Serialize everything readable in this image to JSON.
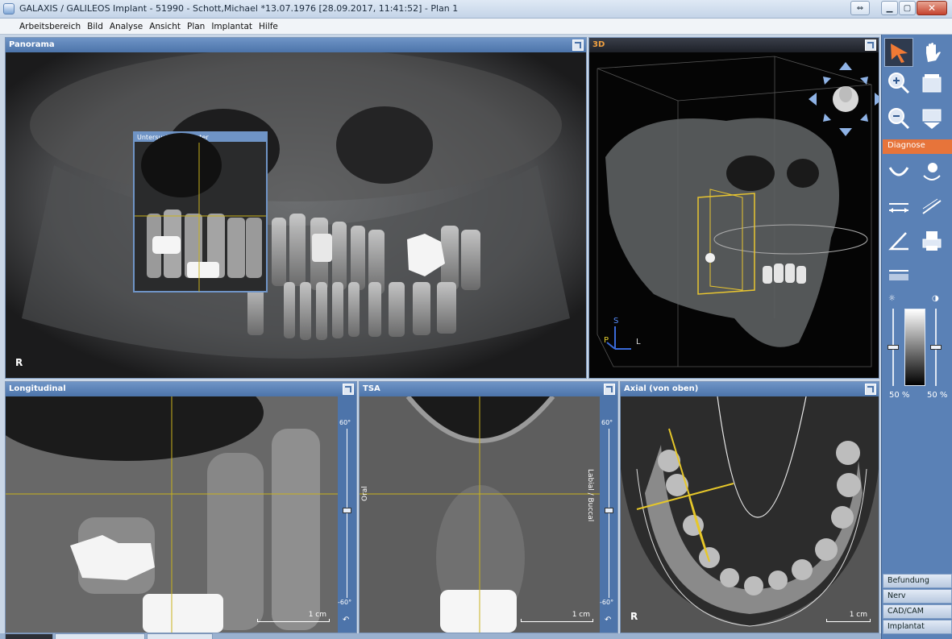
{
  "window": {
    "title": "GALAXIS / GALILEOS Implant - 51990 - Schott,Michael *13.07.1976 [28.09.2017, 11:41:52] - Plan 1"
  },
  "menu": [
    "Arbeitsbereich",
    "Bild",
    "Analyse",
    "Ansicht",
    "Plan",
    "Implantat",
    "Hilfe"
  ],
  "panels": {
    "panorama": {
      "title": "Panorama",
      "corner": "R",
      "exam_window": "Untersuchungsfenster"
    },
    "view3d": {
      "title": "3D",
      "axis_s": "S",
      "axis_p": "P",
      "axis_l": "L"
    },
    "longitudinal": {
      "title": "Longitudinal",
      "scale": "1 cm",
      "tilt_top": "60°",
      "tilt_bottom": "-60°"
    },
    "tsa": {
      "title": "TSA",
      "scale": "1 cm",
      "tilt_top": "60°",
      "tilt_bottom": "-60°",
      "left_label": "Oral",
      "right_label": "Labial / Buccal"
    },
    "axial": {
      "title": "Axial (von oben)",
      "scale": "1 cm",
      "corner": "R"
    }
  },
  "toolpanel": {
    "tab": "Diagnose",
    "brightness_pct": "50 %",
    "contrast_pct": "50 %",
    "brightness_level": 0.5,
    "contrast_level": 0.5,
    "side_tabs": [
      "Befundung",
      "Nerv",
      "CAD/CAM",
      "Implantat"
    ]
  }
}
